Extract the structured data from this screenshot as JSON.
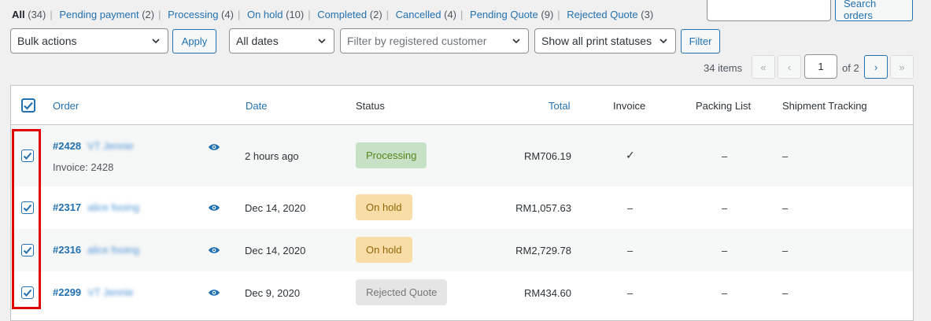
{
  "status_filters": [
    {
      "label": "All",
      "count": "(34)",
      "current": true
    },
    {
      "label": "Pending payment",
      "count": "(2)"
    },
    {
      "label": "Processing",
      "count": "(4)"
    },
    {
      "label": "On hold",
      "count": "(10)"
    },
    {
      "label": "Completed",
      "count": "(2)"
    },
    {
      "label": "Cancelled",
      "count": "(4)"
    },
    {
      "label": "Pending Quote",
      "count": "(9)"
    },
    {
      "label": "Rejected Quote",
      "count": "(3)"
    }
  ],
  "search": {
    "placeholder": "",
    "button": "Search orders"
  },
  "toolbar": {
    "bulk_actions": "Bulk actions",
    "apply": "Apply",
    "dates": "All dates",
    "customer_placeholder": "Filter by registered customer",
    "print_statuses": "Show all print statuses",
    "filter": "Filter"
  },
  "pagination": {
    "items": "34 items",
    "first": "«",
    "prev": "‹",
    "current_page": "1",
    "of": "of 2",
    "next": "›",
    "last": "»"
  },
  "columns": {
    "order": "Order",
    "date": "Date",
    "status": "Status",
    "total": "Total",
    "invoice": "Invoice",
    "packing": "Packing List",
    "tracking": "Shipment Tracking"
  },
  "rows": [
    {
      "order": "#2428",
      "customer": "VT Jennie",
      "sub": "Invoice: 2428",
      "date": "2 hours ago",
      "status": "Processing",
      "total": "RM706.19",
      "invoice": "✓",
      "packing": "–",
      "tracking": "–"
    },
    {
      "order": "#2317",
      "customer": "alice fooing",
      "date": "Dec 14, 2020",
      "status": "On hold",
      "total": "RM1,057.63",
      "invoice": "–",
      "packing": "–",
      "tracking": "–"
    },
    {
      "order": "#2316",
      "customer": "alice fooing",
      "date": "Dec 14, 2020",
      "status": "On hold",
      "total": "RM2,729.78",
      "invoice": "–",
      "packing": "–",
      "tracking": "–"
    },
    {
      "order": "#2299",
      "customer": "VT Jennie",
      "date": "Dec 9, 2020",
      "status": "Rejected Quote",
      "total": "RM434.60",
      "invoice": "–",
      "packing": "–",
      "tracking": "–"
    }
  ],
  "colors": {
    "link": "#2271b1",
    "processing_bg": "#c6e1c6",
    "onhold_bg": "#f8dda7",
    "rejected_bg": "#e5e5e5",
    "highlight": "#e00000"
  }
}
